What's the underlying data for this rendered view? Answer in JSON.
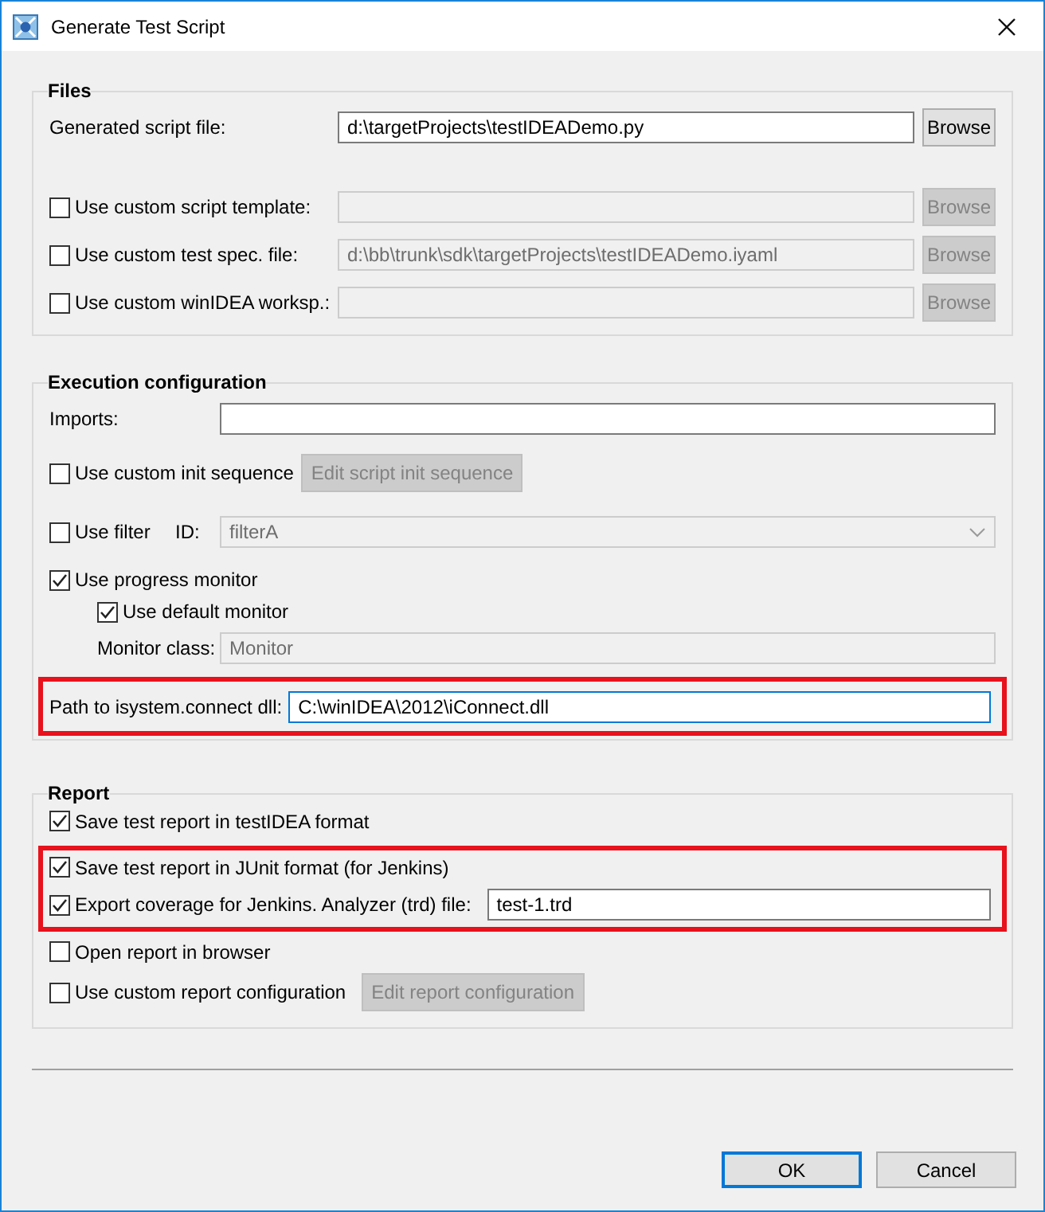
{
  "window": {
    "title": "Generate Test Script"
  },
  "files": {
    "title": "Files",
    "script_file": {
      "label": "Generated script file:",
      "value": "d:\\targetProjects\\testIDEADemo.py",
      "button": {
        "label": "Browse",
        "disabled": false
      }
    },
    "custom_rows": [
      {
        "label": "Use custom script template:",
        "checked": false,
        "disabled": true,
        "button": {
          "label": "Browse",
          "disabled": true
        }
      },
      {
        "label": "Use custom test spec. file:",
        "checked": false,
        "disabled": true,
        "value": "d:\\bb\\trunk\\sdk\\targetProjects\\testIDEADemo.iyaml",
        "button": {
          "label": "Browse",
          "disabled": true
        }
      },
      {
        "label": "Use custom winIDEA worksp.:",
        "checked": false,
        "disabled": true,
        "button": {
          "label": "Browse",
          "disabled": true
        }
      }
    ]
  },
  "execution": {
    "title": "Execution configuration",
    "imports": {
      "label": "Imports:"
    },
    "init_sequence": {
      "label": "Use custom init sequence",
      "checked": false,
      "button": {
        "label": "Edit script init sequence",
        "disabled": true
      }
    },
    "filter": {
      "label": "Use filter",
      "checked": false,
      "id_label": "ID:",
      "value": "filterA",
      "disabled": true
    },
    "progress": {
      "label": "Use progress monitor",
      "checked": true,
      "children": [
        {
          "label": "Use default monitor",
          "checked": true
        }
      ]
    },
    "monitor_class": {
      "label": "Monitor class:",
      "value": "Monitor",
      "disabled": true
    },
    "dll_path": {
      "label": "Path to isystem.connect dll:",
      "value": "C:\\winIDEA\\2012\\iConnect.dll",
      "highlighted": true,
      "focused": true
    }
  },
  "report": {
    "title": "Report",
    "items": [
      {
        "kind": "check",
        "label": "Save test report in testIDEA format",
        "checked": true,
        "highlighted": false
      },
      {
        "kind": "check",
        "label": "Save test report in JUnit format (for Jenkins)",
        "checked": true,
        "highlighted": true
      },
      {
        "kind": "check-field",
        "label": "Export coverage for Jenkins. Analyzer (trd) file:",
        "checked": true,
        "value": "test-1.trd",
        "highlighted": true
      },
      {
        "kind": "check",
        "label": "Open report in browser",
        "checked": false,
        "highlighted": false
      },
      {
        "kind": "check-button",
        "label": "Use custom report configuration",
        "checked": false,
        "highlighted": false,
        "button": {
          "label": "Edit report configuration",
          "disabled": true
        }
      }
    ]
  },
  "buttons": [
    {
      "label": "OK",
      "default": true
    },
    {
      "label": "Cancel",
      "default": false
    }
  ]
}
